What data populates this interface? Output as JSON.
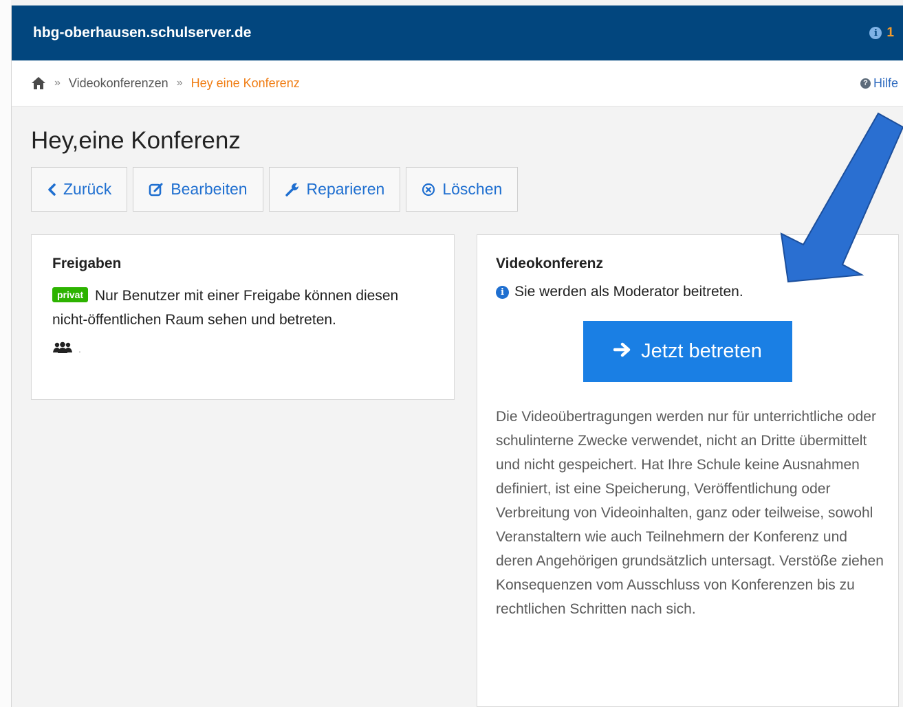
{
  "header": {
    "site_title": "hbg-oberhausen.schulserver.de",
    "notification_count": "1"
  },
  "breadcrumb": {
    "items": [
      "Videokonferenzen",
      "Hey eine Konferenz"
    ],
    "separator": "»",
    "help_label": "Hilfe"
  },
  "page": {
    "title": "Hey,eine Konferenz"
  },
  "toolbar": {
    "back_label": "Zurück",
    "edit_label": "Bearbeiten",
    "repair_label": "Reparieren",
    "delete_label": "Löschen"
  },
  "shares": {
    "heading": "Freigaben",
    "badge": "privat",
    "text": "Nur Benutzer mit einer Freigabe können diesen nicht-öffentlichen Raum sehen und betreten.",
    "users_suffix": "."
  },
  "conference": {
    "heading": "Videokonferenz",
    "moderator_info": "Sie werden als Moderator beitreten.",
    "join_label": "Jetzt betreten",
    "disclaimer": "Die Videoübertragungen werden nur für unterrichtliche oder schulinterne Zwecke verwendet, nicht an Dritte übermittelt und nicht gespeichert. Hat Ihre Schule keine Ausnahmen definiert, ist eine Speicherung, Veröffentlichung oder Verbreitung von Videoinhalten, ganz oder teilweise, sowohl Veranstaltern wie auch Teilnehmern der Konferenz und deren Angehörigen grundsätzlich untersagt. Verstöße ziehen Konsequenzen vom Ausschluss von Konferenzen bis zu rechtlichen Schritten nach sich."
  },
  "colors": {
    "header_bg": "#02467e",
    "accent_blue": "#1a7fe4",
    "breadcrumb_active": "#f07c12",
    "badge_green": "#2db300",
    "annotation_arrow": "#2a6fd1"
  },
  "icons": {
    "home": "home-icon",
    "back": "chevron-left-icon",
    "edit": "edit-icon",
    "repair": "wrench-icon",
    "delete": "circle-x-icon",
    "users": "users-icon",
    "join": "arrow-right-icon",
    "help": "question-circle-icon",
    "info": "info-circle-icon"
  }
}
